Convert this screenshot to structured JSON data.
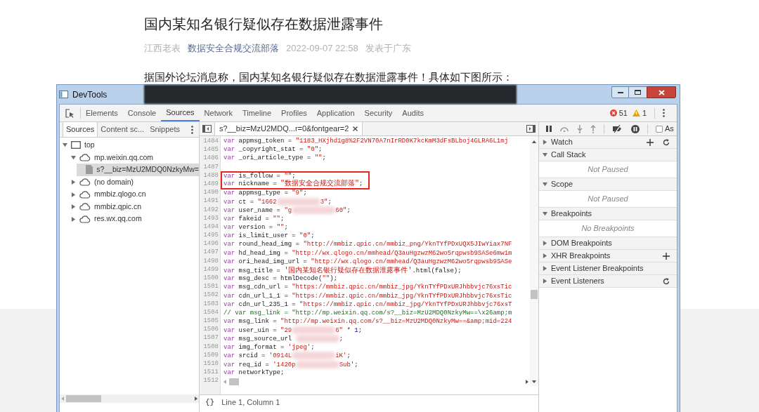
{
  "article": {
    "title": "国内某知名银行疑似存在数据泄露事件",
    "meta": [
      {
        "kind": "author",
        "text": "江西老表"
      },
      {
        "kind": "account",
        "text": "数据安全合规交流部落"
      },
      {
        "kind": "date",
        "text": "2022-09-07 22:58"
      },
      {
        "kind": "location",
        "text": "发表于广东"
      }
    ],
    "paragraph": "据国外论坛消息称，国内某知名银行疑似存在数据泄露事件！具体如下图所示："
  },
  "devtools": {
    "window_title": "DevTools",
    "tabs": [
      {
        "label": "Elements",
        "selected": false
      },
      {
        "label": "Console",
        "selected": false
      },
      {
        "label": "Sources",
        "selected": true
      },
      {
        "label": "Network",
        "selected": false
      },
      {
        "label": "Timeline",
        "selected": false
      },
      {
        "label": "Profiles",
        "selected": false
      },
      {
        "label": "Application",
        "selected": false
      },
      {
        "label": "Security",
        "selected": false
      },
      {
        "label": "Audits",
        "selected": false
      }
    ],
    "errors": "51",
    "warnings": "1",
    "navigator": {
      "tabs": [
        {
          "label": "Sources",
          "selected": true
        },
        {
          "label": "Content sc...",
          "selected": false
        },
        {
          "label": "Snippets",
          "selected": false
        }
      ],
      "tree": [
        {
          "label": "top",
          "kind": "frame",
          "expanded": true,
          "selected": false,
          "children": [
            {
              "label": "mp.weixin.qq.com",
              "kind": "domain",
              "expanded": true,
              "selected": false,
              "children": [
                {
                  "label": "s?__biz=MzU2MDQ0NzkyMw=",
                  "kind": "file",
                  "selected": true
                }
              ]
            },
            {
              "label": "(no domain)",
              "kind": "domain",
              "expanded": false,
              "selected": false
            },
            {
              "label": "mmbiz.qlogo.cn",
              "kind": "domain",
              "expanded": false,
              "selected": false
            },
            {
              "label": "mmbiz.qpic.cn",
              "kind": "domain",
              "expanded": false,
              "selected": false
            },
            {
              "label": "res.wx.qq.com",
              "kind": "domain",
              "expanded": false,
              "selected": false
            }
          ]
        }
      ]
    },
    "editor": {
      "tab": "s?__biz=MzU2MDQ...r=0&fontgear=2",
      "format_button": "{}",
      "status": "Line 1, Column 1",
      "lines": [
        {
          "number": "1484",
          "boxed": false,
          "segments": [
            {
              "kind": "keyword",
              "text": "var"
            },
            {
              "kind": "plain",
              "text": " appmsg_token = "
            },
            {
              "kind": "string",
              "text": "\"1183_HXjhd1g8%2F2VN70A7nIrRD0K7kcKmM3dFsBLboj4GLRA6L1mj"
            }
          ]
        },
        {
          "number": "1485",
          "boxed": false,
          "segments": [
            {
              "kind": "keyword",
              "text": "var"
            },
            {
              "kind": "plain",
              "text": " _copyright_stat = "
            },
            {
              "kind": "string",
              "text": "\"0\""
            },
            {
              "kind": "plain",
              "text": ";"
            }
          ]
        },
        {
          "number": "1486",
          "boxed": false,
          "segments": [
            {
              "kind": "keyword",
              "text": "var"
            },
            {
              "kind": "plain",
              "text": " _ori_article_type = "
            },
            {
              "kind": "string",
              "text": "\"\""
            },
            {
              "kind": "plain",
              "text": ";"
            }
          ]
        },
        {
          "number": "1487",
          "boxed": false
        },
        {
          "number": "1488",
          "boxed": true,
          "segments": [
            {
              "kind": "keyword",
              "text": "var"
            },
            {
              "kind": "plain",
              "text": " is_follow = "
            },
            {
              "kind": "string",
              "text": "\"\""
            },
            {
              "kind": "plain",
              "text": ";"
            }
          ]
        },
        {
          "number": "1489",
          "boxed": true,
          "segments": [
            {
              "kind": "keyword",
              "text": "var"
            },
            {
              "kind": "plain",
              "text": " nickname = "
            },
            {
              "kind": "string",
              "text": "\"数据安全合规交流部落\""
            },
            {
              "kind": "plain",
              "text": ";"
            }
          ]
        },
        {
          "number": "1490",
          "boxed": false,
          "segments": [
            {
              "kind": "keyword",
              "text": "var"
            },
            {
              "kind": "plain",
              "text": " appmsg_type = "
            },
            {
              "kind": "string",
              "text": "\"9\""
            },
            {
              "kind": "plain",
              "text": ";"
            }
          ]
        },
        {
          "number": "1491",
          "boxed": false,
          "segments": [
            {
              "kind": "keyword",
              "text": "var"
            },
            {
              "kind": "plain",
              "text": " ct = "
            },
            {
              "kind": "string",
              "text": "\"1662"
            },
            {
              "kind": "redacted"
            },
            {
              "kind": "string",
              "text": "3\""
            },
            {
              "kind": "plain",
              "text": ";"
            }
          ]
        },
        {
          "number": "1492",
          "boxed": false,
          "segments": [
            {
              "kind": "keyword",
              "text": "var"
            },
            {
              "kind": "plain",
              "text": " user_name = "
            },
            {
              "kind": "string",
              "text": "\"g"
            },
            {
              "kind": "redacted"
            },
            {
              "kind": "string",
              "text": "60\""
            },
            {
              "kind": "plain",
              "text": ";"
            }
          ]
        },
        {
          "number": "1493",
          "boxed": false,
          "segments": [
            {
              "kind": "keyword",
              "text": "var"
            },
            {
              "kind": "plain",
              "text": " fakeid = "
            },
            {
              "kind": "string",
              "text": "\"\""
            },
            {
              "kind": "plain",
              "text": ";"
            }
          ]
        },
        {
          "number": "1494",
          "boxed": false,
          "segments": [
            {
              "kind": "keyword",
              "text": "var"
            },
            {
              "kind": "plain",
              "text": " version = "
            },
            {
              "kind": "string",
              "text": "\"\""
            },
            {
              "kind": "plain",
              "text": ";"
            }
          ]
        },
        {
          "number": "1495",
          "boxed": false,
          "segments": [
            {
              "kind": "keyword",
              "text": "var"
            },
            {
              "kind": "plain",
              "text": " is_limit_user = "
            },
            {
              "kind": "string",
              "text": "\"0\""
            },
            {
              "kind": "plain",
              "text": ";"
            }
          ]
        },
        {
          "number": "1496",
          "boxed": false,
          "segments": [
            {
              "kind": "keyword",
              "text": "var"
            },
            {
              "kind": "plain",
              "text": " round_head_img = "
            },
            {
              "kind": "string",
              "text": "\"http://mmbiz.qpic.cn/mmbiz_png/YknTYfPDxUQX5JIwYiax7NF"
            }
          ]
        },
        {
          "number": "1497",
          "boxed": false,
          "segments": [
            {
              "kind": "keyword",
              "text": "var"
            },
            {
              "kind": "plain",
              "text": " hd_head_img = "
            },
            {
              "kind": "string",
              "text": "\"http://wx.qlogo.cn/mmhead/Q3auHgzwzM62wo5rqpwsb9SASe6mw1m"
            }
          ]
        },
        {
          "number": "1498",
          "boxed": false,
          "segments": [
            {
              "kind": "keyword",
              "text": "var"
            },
            {
              "kind": "plain",
              "text": " ori_head_img_url = "
            },
            {
              "kind": "string",
              "text": "\"http://wx.qlogo.cn/mmhead/Q3auHgzwzM62wo5rqpwsb9SASe"
            }
          ]
        },
        {
          "number": "1499",
          "boxed": false,
          "segments": [
            {
              "kind": "keyword",
              "text": "var"
            },
            {
              "kind": "plain",
              "text": " msg_title = "
            },
            {
              "kind": "string",
              "text": "'国内某知名银行疑似存在数据泄露事件'"
            },
            {
              "kind": "plain",
              "text": ".html(false);"
            }
          ]
        },
        {
          "number": "1500",
          "boxed": false,
          "segments": [
            {
              "kind": "keyword",
              "text": "var"
            },
            {
              "kind": "plain",
              "text": " msg_desc = htmlDecode("
            },
            {
              "kind": "string",
              "text": "\"\""
            },
            {
              "kind": "plain",
              "text": ");"
            }
          ]
        },
        {
          "number": "1501",
          "boxed": false,
          "segments": [
            {
              "kind": "keyword",
              "text": "var"
            },
            {
              "kind": "plain",
              "text": " msg_cdn_url = "
            },
            {
              "kind": "string",
              "text": "\"https://mmbiz.qpic.cn/mmbiz_jpg/YknTYfPDxURJhbbvjc76xsTic"
            }
          ]
        },
        {
          "number": "1502",
          "boxed": false,
          "segments": [
            {
              "kind": "keyword",
              "text": "var"
            },
            {
              "kind": "plain",
              "text": " cdn_url_1_1 = "
            },
            {
              "kind": "string",
              "text": "\"https://mmbiz.qpic.cn/mmbiz_jpg/YknTYfPDxURJhbbvjc76xsTic"
            }
          ]
        },
        {
          "number": "1503",
          "boxed": false,
          "segments": [
            {
              "kind": "keyword",
              "text": "var"
            },
            {
              "kind": "plain",
              "text": " cdn_url_235_1 = "
            },
            {
              "kind": "string",
              "text": "\"https://mmbiz.qpic.cn/mmbiz_jpg/YknTYfPDxURJhbbvjc76xsT"
            }
          ]
        },
        {
          "number": "1504",
          "boxed": false,
          "segments": [
            {
              "kind": "comment",
              "text": "// var msg_link = \"http://mp.weixin.qq.com/s?__biz=MzU2MDQ0NzkyMw==\\x26amp;m"
            }
          ]
        },
        {
          "number": "1505",
          "boxed": false,
          "segments": [
            {
              "kind": "keyword",
              "text": "var"
            },
            {
              "kind": "plain",
              "text": " msg_link = "
            },
            {
              "kind": "string",
              "text": "\"http://mp.weixin.qq.com/s?__biz=MzU2MDQ0NzkyMw==&amp;mid=224"
            }
          ]
        },
        {
          "number": "1506",
          "boxed": false,
          "segments": [
            {
              "kind": "keyword",
              "text": "var"
            },
            {
              "kind": "plain",
              "text": " user_uin = "
            },
            {
              "kind": "string",
              "text": "\"29"
            },
            {
              "kind": "redacted"
            },
            {
              "kind": "string",
              "text": "6\""
            },
            {
              "kind": "plain",
              "text": " * "
            },
            {
              "kind": "number",
              "text": "1"
            },
            {
              "kind": "plain",
              "text": ";"
            }
          ]
        },
        {
          "number": "1507",
          "boxed": false,
          "segments": [
            {
              "kind": "keyword",
              "text": "var"
            },
            {
              "kind": "plain",
              "text": " msg_source_url "
            },
            {
              "kind": "redacted"
            },
            {
              "kind": "plain",
              "text": ";"
            }
          ]
        },
        {
          "number": "1508",
          "boxed": false,
          "segments": [
            {
              "kind": "keyword",
              "text": "var"
            },
            {
              "kind": "plain",
              "text": " img_format = "
            },
            {
              "kind": "string",
              "text": "'jpeg'"
            },
            {
              "kind": "plain",
              "text": ";"
            }
          ]
        },
        {
          "number": "1509",
          "boxed": false,
          "segments": [
            {
              "kind": "keyword",
              "text": "var"
            },
            {
              "kind": "plain",
              "text": " srcid = "
            },
            {
              "kind": "string",
              "text": "'0914L"
            },
            {
              "kind": "redacted"
            },
            {
              "kind": "string",
              "text": "iK'"
            },
            {
              "kind": "plain",
              "text": ";"
            }
          ]
        },
        {
          "number": "1510",
          "boxed": false,
          "segments": [
            {
              "kind": "keyword",
              "text": "var"
            },
            {
              "kind": "plain",
              "text": " req_id = "
            },
            {
              "kind": "string",
              "text": "'1420p"
            },
            {
              "kind": "redacted"
            },
            {
              "kind": "string",
              "text": "Sub'"
            },
            {
              "kind": "plain",
              "text": ";"
            }
          ]
        },
        {
          "number": "1511",
          "boxed": false,
          "segments": [
            {
              "kind": "keyword",
              "text": "var"
            },
            {
              "kind": "plain",
              "text": " networkType;"
            }
          ]
        },
        {
          "number": "1512",
          "boxed": false
        }
      ]
    },
    "debugger": {
      "async_label": "As",
      "async_checked": false,
      "sections": [
        {
          "title": "Watch",
          "expanded": false,
          "add_button": true,
          "refresh_button": true
        },
        {
          "title": "Call Stack",
          "expanded": true,
          "message": "Not Paused"
        },
        {
          "title": "Scope",
          "expanded": true,
          "message": "Not Paused"
        },
        {
          "title": "Breakpoints",
          "expanded": true,
          "message": "No Breakpoints"
        },
        {
          "title": "DOM Breakpoints",
          "expanded": false
        },
        {
          "title": "XHR Breakpoints",
          "expanded": false,
          "add_button": true
        },
        {
          "title": "Event Listener Breakpoints",
          "expanded": false
        },
        {
          "title": "Event Listeners",
          "expanded": false,
          "refresh_button": true
        }
      ]
    }
  }
}
